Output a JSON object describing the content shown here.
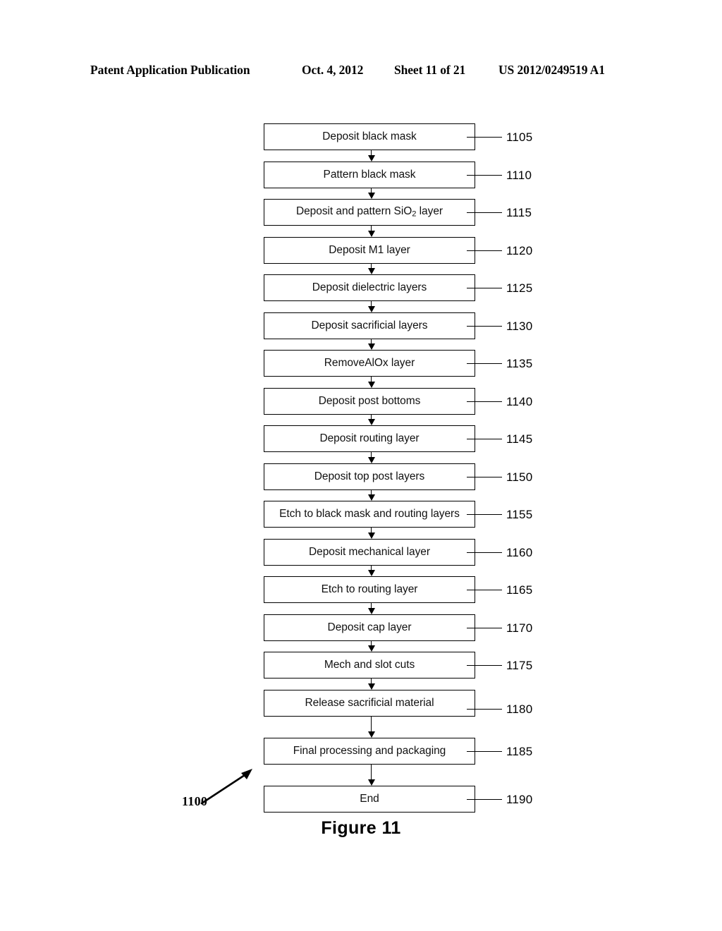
{
  "header": {
    "publication": "Patent Application Publication",
    "date": "Oct. 4, 2012",
    "sheet": "Sheet 11 of 21",
    "patent_number": "US 2012/0249519 A1"
  },
  "figure": {
    "caption": "Figure 11",
    "diagram_ref": "1100",
    "type": "flowchart"
  },
  "flowchart": {
    "steps": [
      {
        "label": "Deposit black mask",
        "ref": "1105"
      },
      {
        "label": "Pattern black mask",
        "ref": "1110"
      },
      {
        "label": "Deposit and pattern SiO2 layer",
        "ref": "1115",
        "subscript": true
      },
      {
        "label": "Deposit M1 layer",
        "ref": "1120"
      },
      {
        "label": "Deposit dielectric layers",
        "ref": "1125"
      },
      {
        "label": "Deposit sacrificial layers",
        "ref": "1130"
      },
      {
        "label": "RemoveAlOx layer",
        "ref": "1135"
      },
      {
        "label": "Deposit post bottoms",
        "ref": "1140"
      },
      {
        "label": "Deposit routing layer",
        "ref": "1145"
      },
      {
        "label": "Deposit top post layers",
        "ref": "1150"
      },
      {
        "label": "Etch to black mask and routing layers",
        "ref": "1155"
      },
      {
        "label": "Deposit mechanical layer",
        "ref": "1160"
      },
      {
        "label": "Etch to routing layer",
        "ref": "1165"
      },
      {
        "label": "Deposit cap layer",
        "ref": "1170"
      },
      {
        "label": "Mech  and slot cuts",
        "ref": "1175"
      },
      {
        "label": "Release sacrificial material",
        "ref": "1180"
      },
      {
        "label": "Final processing and packaging",
        "ref": "1185"
      },
      {
        "label": "End",
        "ref": "1190"
      }
    ]
  },
  "colors": {
    "ink": "#000000",
    "paper": "#ffffff"
  }
}
